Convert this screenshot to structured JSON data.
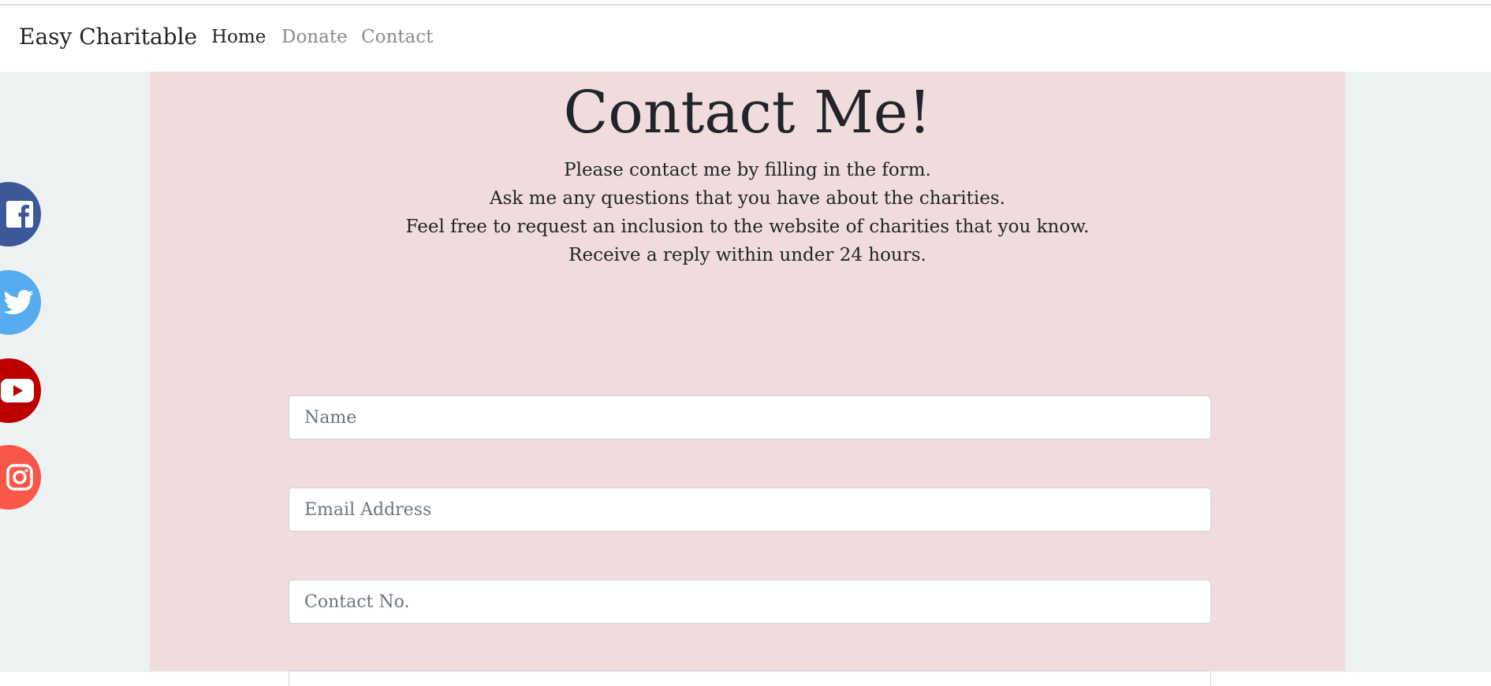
{
  "nav": {
    "brand": "Easy Charitable",
    "links": [
      "Home",
      "Donate",
      "Contact"
    ]
  },
  "main": {
    "title": "Contact Me!",
    "intro": [
      "Please contact me by filling in the form.",
      "Ask me any questions that you have about the charities.",
      "Feel free to request an inclusion to the website of charities that you know.",
      "Receive a reply within under 24 hours."
    ]
  },
  "form": {
    "name_placeholder": "Name",
    "email_placeholder": "Email Address",
    "phone_placeholder": "Contact No."
  },
  "social": {
    "icons": [
      "facebook-icon",
      "twitter-icon",
      "youtube-icon",
      "instagram-icon"
    ],
    "colors": {
      "facebook": "#3b5998",
      "twitter": "#55acee",
      "youtube": "#bb0000",
      "instagram": "#f9564a"
    }
  },
  "colors": {
    "page_background": "#eef1f2",
    "content_background": "#f0dcdc",
    "nav_background": "#ffffff"
  }
}
